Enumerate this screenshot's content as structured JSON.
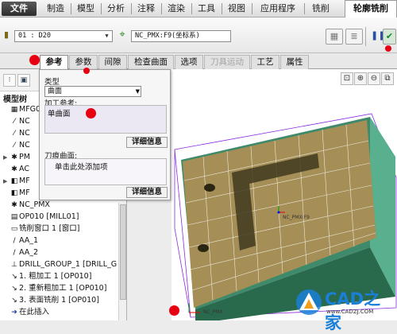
{
  "menu": {
    "file": "文件",
    "tabs": [
      "制造",
      "模型",
      "分析",
      "注释",
      "渲染",
      "工具",
      "视图",
      "应用程序",
      "铣削"
    ],
    "active_tab": "轮廓铣削"
  },
  "ribbon": {
    "tool_value": "01 : D20",
    "csys_value": "NC_PMX:F9(坐标系)"
  },
  "subtabs": [
    {
      "label": "参考",
      "state": "selected"
    },
    {
      "label": "参数",
      "state": "normal"
    },
    {
      "label": "间隙",
      "state": "normal"
    },
    {
      "label": "检查曲面",
      "state": "normal"
    },
    {
      "label": "选项",
      "state": "normal"
    },
    {
      "label": "刀具运动",
      "state": "disabled"
    },
    {
      "label": "工艺",
      "state": "normal"
    },
    {
      "label": "属性",
      "state": "normal"
    }
  ],
  "tree": {
    "header": "模型树",
    "items": [
      {
        "label": "MFG0"
      },
      {
        "label": "NC"
      },
      {
        "label": "NC"
      },
      {
        "label": "NC"
      },
      {
        "label": "PM"
      },
      {
        "label": "AC"
      },
      {
        "label": "MF"
      },
      {
        "label": "MF"
      },
      {
        "label": "NC_PMX"
      },
      {
        "label": "OP010 [MILL01]"
      },
      {
        "label": "铣削窗口 1 [窗口]"
      },
      {
        "label": "AA_1"
      },
      {
        "label": "AA_2"
      },
      {
        "label": "DRILL_GROUP_1 [DRILL_G"
      },
      {
        "label": "1. 粗加工 1 [OP010]"
      },
      {
        "label": "2. 重新粗加工 1 [OP010]"
      },
      {
        "label": "3. 表面铣削 1 [OP010]"
      },
      {
        "label": "在此插入"
      }
    ]
  },
  "reference_panel": {
    "type_label": "类型",
    "type_value": "曲面",
    "machining_ref_label": "加工参考:",
    "machining_ref_value": "单曲面",
    "detail_button": "详细信息",
    "cutter_surface_label": "刀痕曲面:",
    "cutter_surface_placeholder": "单击此处添加项",
    "detail_button_2": "详细信息"
  },
  "viewport": {
    "csys_label": "NC_PMX:F9",
    "bottom_csys_label": "NC_PMX"
  },
  "watermark": {
    "name": "CAD之家",
    "url": "www.CADZJ.COM"
  },
  "colors": {
    "annotation_dot": "#e60012",
    "part_top": "#a89258",
    "part_side": "#4f9a78",
    "stock_outline": "#8a2be2",
    "brand_blue": "#1a7fd8"
  }
}
